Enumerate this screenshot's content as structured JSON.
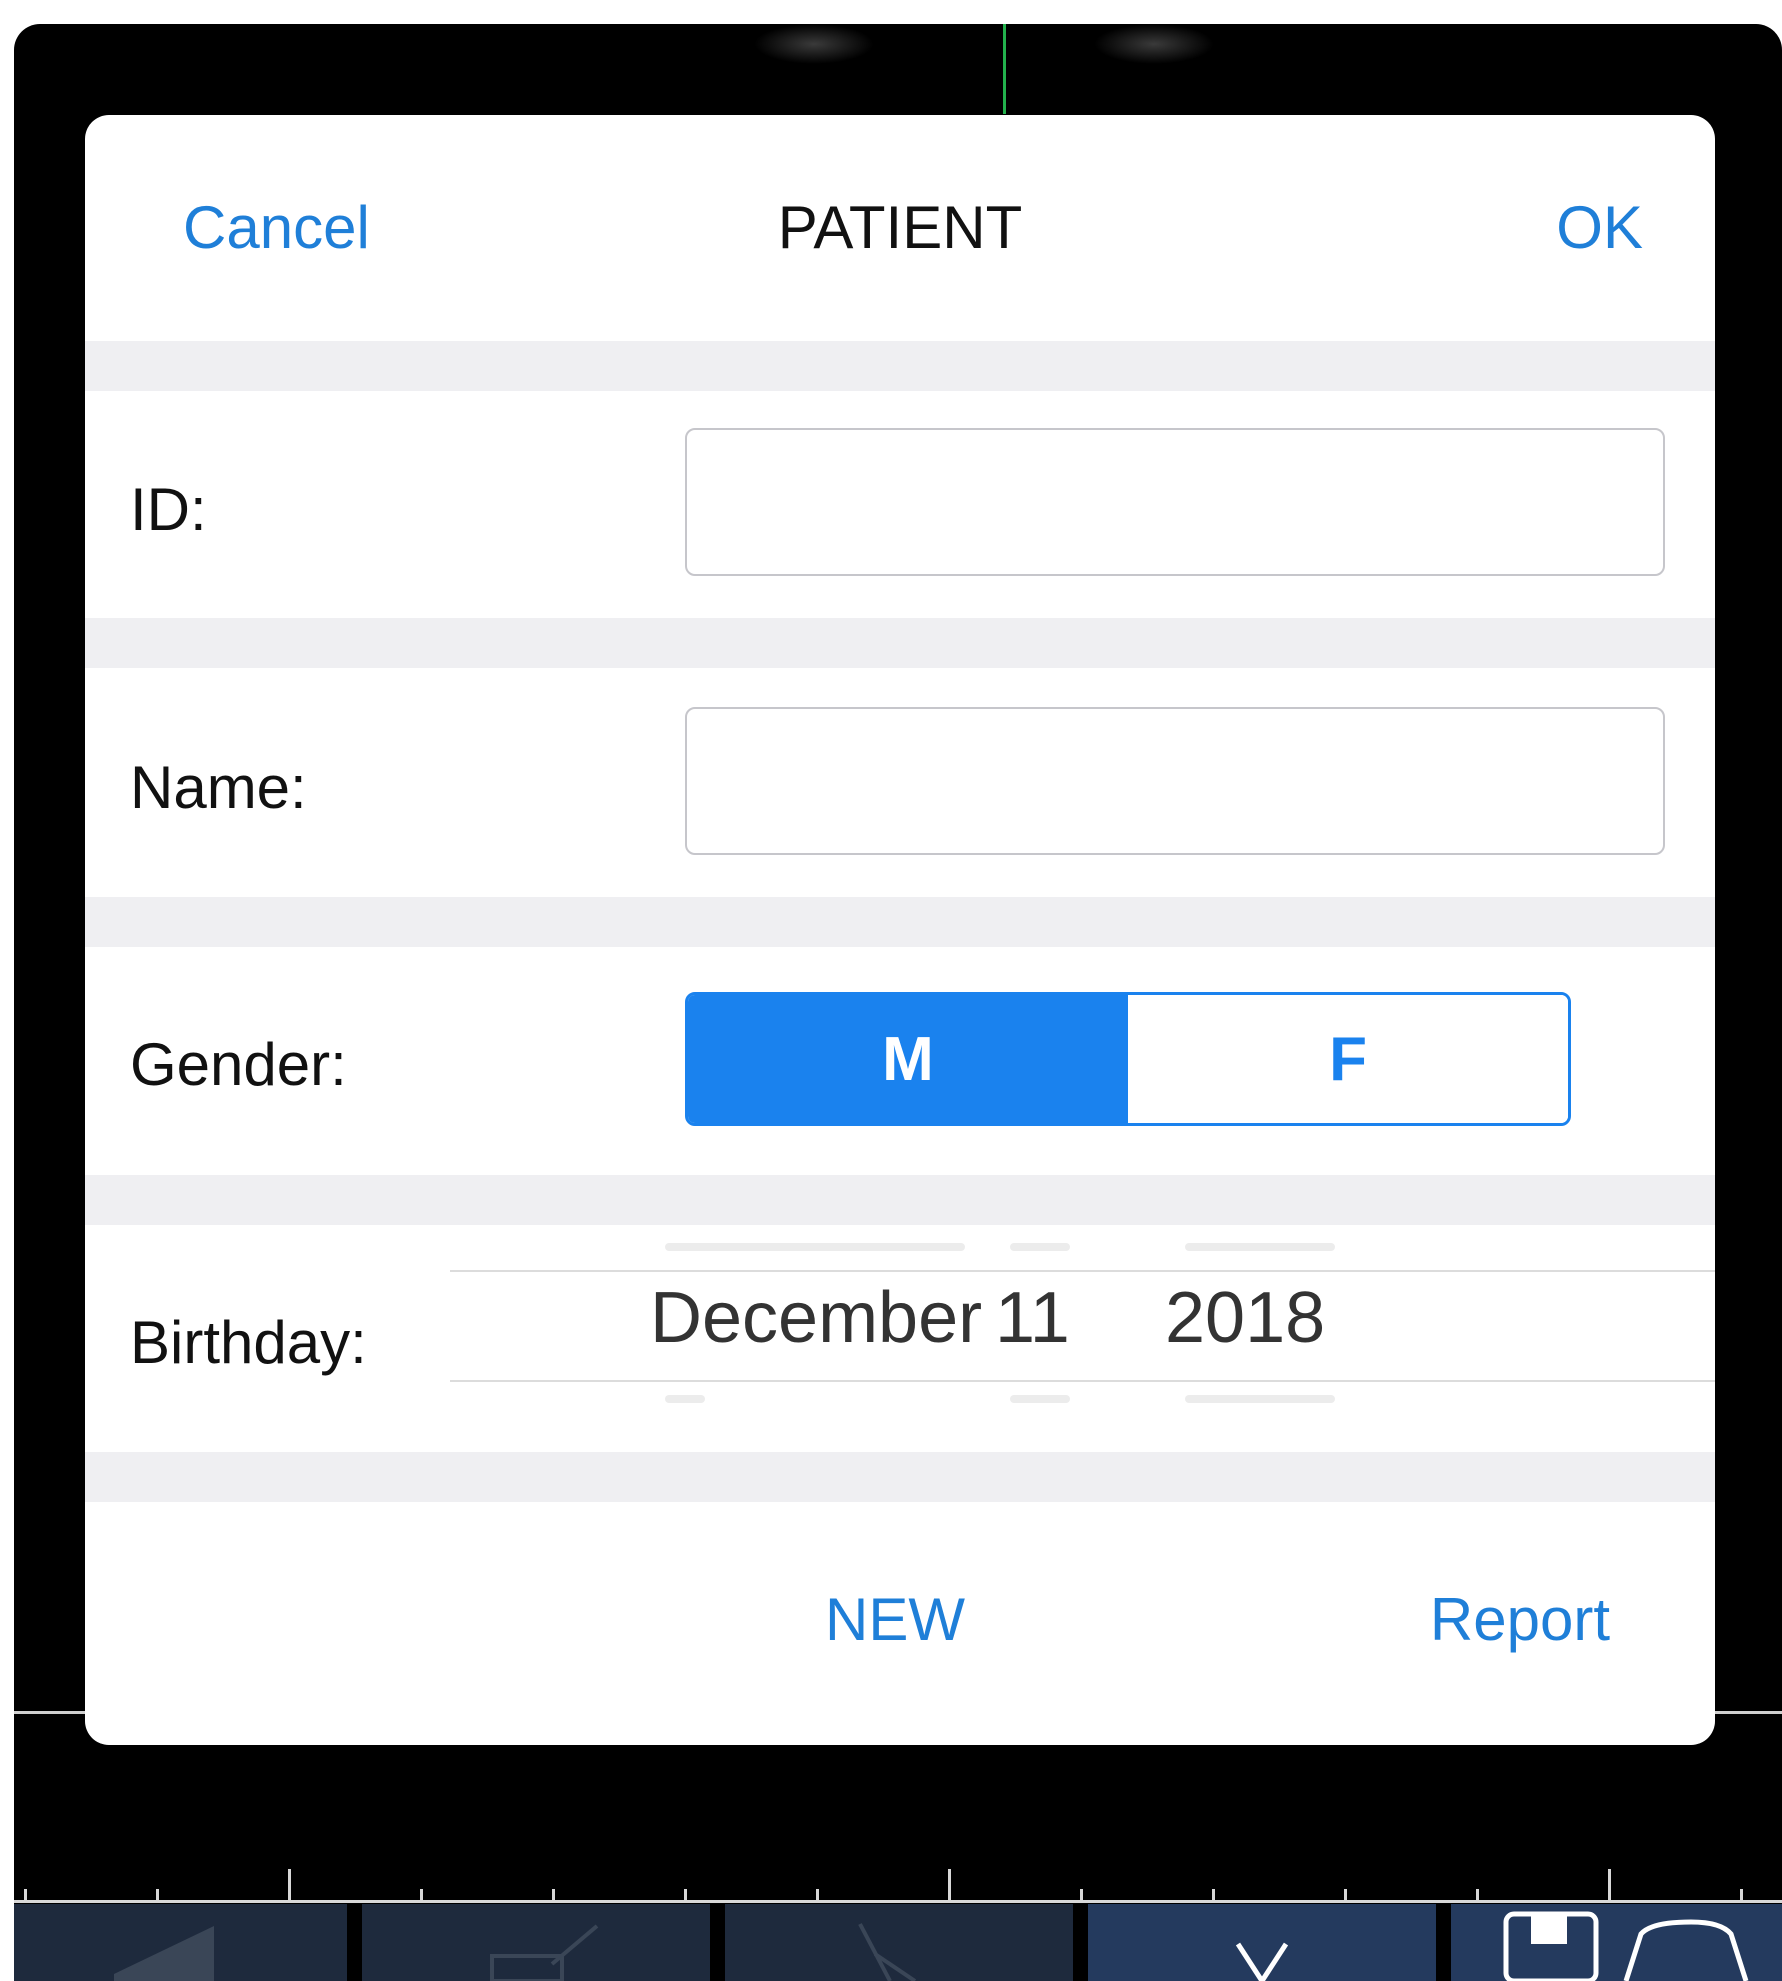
{
  "dialog": {
    "title": "PATIENT",
    "cancel_label": "Cancel",
    "ok_label": "OK"
  },
  "form": {
    "id_label": "ID:",
    "id_value": "",
    "name_label": "Name:",
    "name_value": "",
    "gender_label": "Gender:",
    "gender_options": [
      "M",
      "F"
    ],
    "gender_selected": "M",
    "birthday_label": "Birthday:",
    "birthday_month": "December",
    "birthday_day": "11",
    "birthday_year": "2018"
  },
  "footer": {
    "new_label": "NEW",
    "report_label": "Report"
  },
  "colors": {
    "accent": "#1a82ee",
    "link": "#1f7fd8",
    "background": "#000000",
    "measure_marker": "#22b14c"
  },
  "toolbar": {
    "icons": [
      "speaker-icon",
      "edit-icon",
      "crop-icon",
      "close-icon",
      "save-icon"
    ]
  }
}
